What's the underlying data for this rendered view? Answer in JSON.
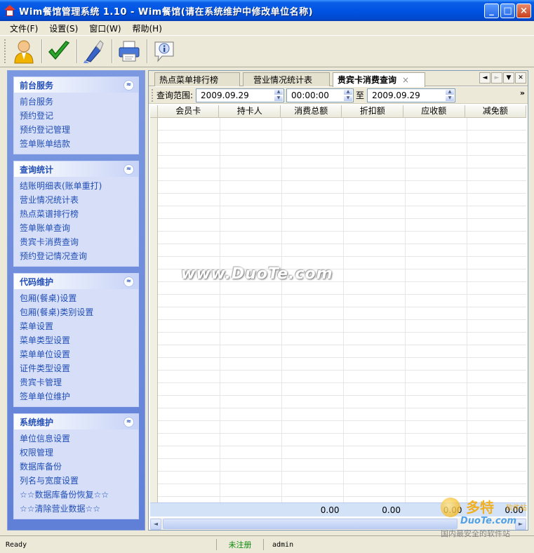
{
  "window": {
    "title": "Wim餐馆管理系统   1.10 - Wim餐馆(请在系统维护中修改单位名称)",
    "minimize_glyph": "_",
    "maximize_glyph": "□",
    "close_glyph": "×"
  },
  "menu": [
    "文件(F)",
    "设置(S)",
    "窗口(W)",
    "帮助(H)"
  ],
  "toolbar": {
    "icons": [
      "user-icon",
      "checkmark-icon",
      "broom-icon",
      "printer-icon",
      "info-balloon-icon"
    ]
  },
  "sidebar": {
    "groups": [
      {
        "title": "前台服务",
        "items": [
          "前台服务",
          "预约登记",
          "预约登记管理",
          "签单账单结款"
        ]
      },
      {
        "title": "查询统计",
        "items": [
          "结账明细表(账单重打)",
          "营业情况统计表",
          "热点菜谱排行榜",
          "签单账单查询",
          "贵宾卡消费查询",
          "预约登记情况查询"
        ]
      },
      {
        "title": "代码维护",
        "items": [
          "包厢(餐桌)设置",
          "包厢(餐桌)类别设置",
          "菜单设置",
          "菜单类型设置",
          "菜单单位设置",
          "证件类型设置",
          "贵宾卡管理",
          "签单单位维护"
        ]
      },
      {
        "title": "系统维护",
        "items": [
          "单位信息设置",
          "权限管理",
          "数据库备份",
          "列名与宽度设置",
          "☆☆数据库备份恢复☆☆",
          "☆☆清除营业数据☆☆"
        ]
      }
    ],
    "collapse_glyph": "≈"
  },
  "tabs": [
    {
      "label": "热点菜单排行榜",
      "active": false
    },
    {
      "label": "营业情况统计表",
      "active": false
    },
    {
      "label": "贵宾卡消费查询",
      "active": true
    }
  ],
  "tab_close_glyph": "×",
  "tab_nav": [
    "◄",
    "►",
    "▼",
    "✕"
  ],
  "query": {
    "label": "查询范围:",
    "start_date": "2009.09.29",
    "start_time": "00:00:00",
    "to_label": "至",
    "end_date": "2009.09.29",
    "more_glyph": "»"
  },
  "grid": {
    "columns": [
      "会员卡",
      "持卡人",
      "消费总额",
      "折扣额",
      "应收额",
      "减免额"
    ],
    "footer": [
      "",
      "",
      "0.00",
      "0.00",
      "0.00",
      "0.00"
    ]
  },
  "scroll": {
    "left_glyph": "◄",
    "right_glyph": "►"
  },
  "status": {
    "ready": "Ready",
    "registration": "未注册",
    "user": "admin"
  },
  "watermarks": {
    "center": "www.DuoTe.com",
    "logo_big": "多特",
    "logo_small": "软件站",
    "logo_site": "DuoTe.com",
    "logo_slogan": "国内最安全的软件站"
  }
}
